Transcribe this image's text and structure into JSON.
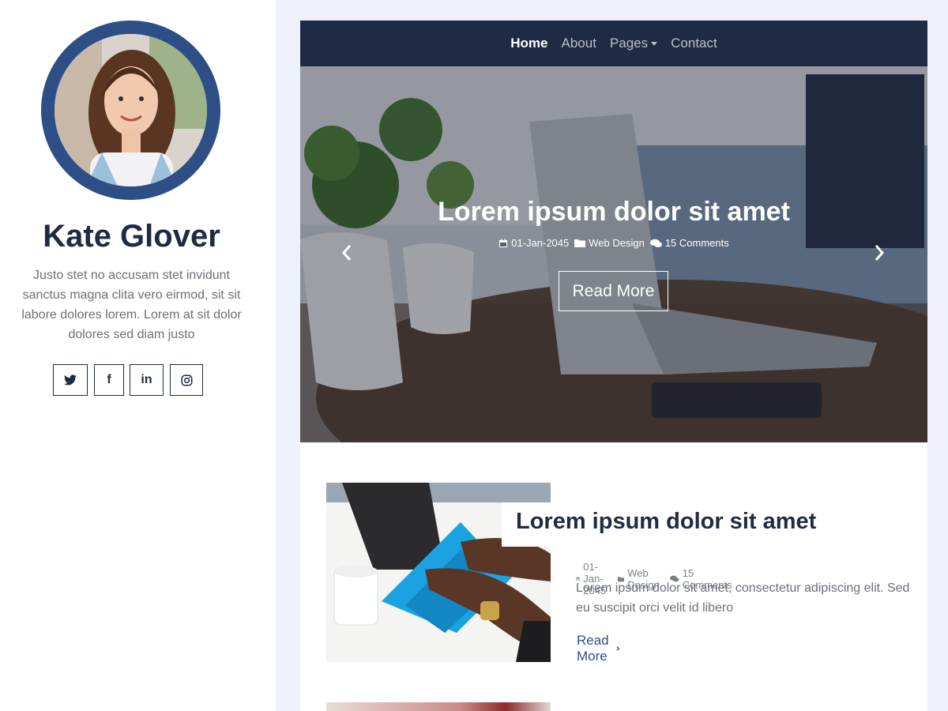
{
  "profile": {
    "name": "Kate Glover",
    "bio": "Justo stet no accusam stet invidunt sanctus magna clita vero eirmod, sit sit labore dolores lorem. Lorem at sit dolor dolores sed diam justo",
    "avatar_alt": "profile-photo",
    "socials": [
      {
        "icon": "twitter-icon",
        "glyph": "🐦"
      },
      {
        "icon": "facebook-icon",
        "glyph": "f"
      },
      {
        "icon": "linkedin-icon",
        "glyph": "in"
      },
      {
        "icon": "instagram-icon",
        "glyph": "◎"
      }
    ]
  },
  "nav": {
    "items": [
      {
        "label": "Home",
        "active": true
      },
      {
        "label": "About",
        "active": false
      },
      {
        "label": "Pages",
        "active": false,
        "dropdown": true
      },
      {
        "label": "Contact",
        "active": false
      }
    ]
  },
  "hero": {
    "title": "Lorem ipsum dolor sit amet",
    "date": "01-Jan-2045",
    "category": "Web Design",
    "comments": "15 Comments",
    "button": "Read More",
    "prev_glyph": "‹",
    "next_glyph": "›"
  },
  "posts": [
    {
      "title": "Lorem ipsum dolor sit amet",
      "date": "01-Jan-2045",
      "category": "Web Design",
      "comments": "15 Comments",
      "excerpt": "Lorem ipsum dolor sit amet, consectetur adipiscing elit. Sed eu suscipit orci velit id libero",
      "read_more": "Read More"
    }
  ],
  "colors": {
    "brand_dark": "#1f2a44",
    "accent": "#2d4f86",
    "page_bg": "#eef0fb"
  }
}
